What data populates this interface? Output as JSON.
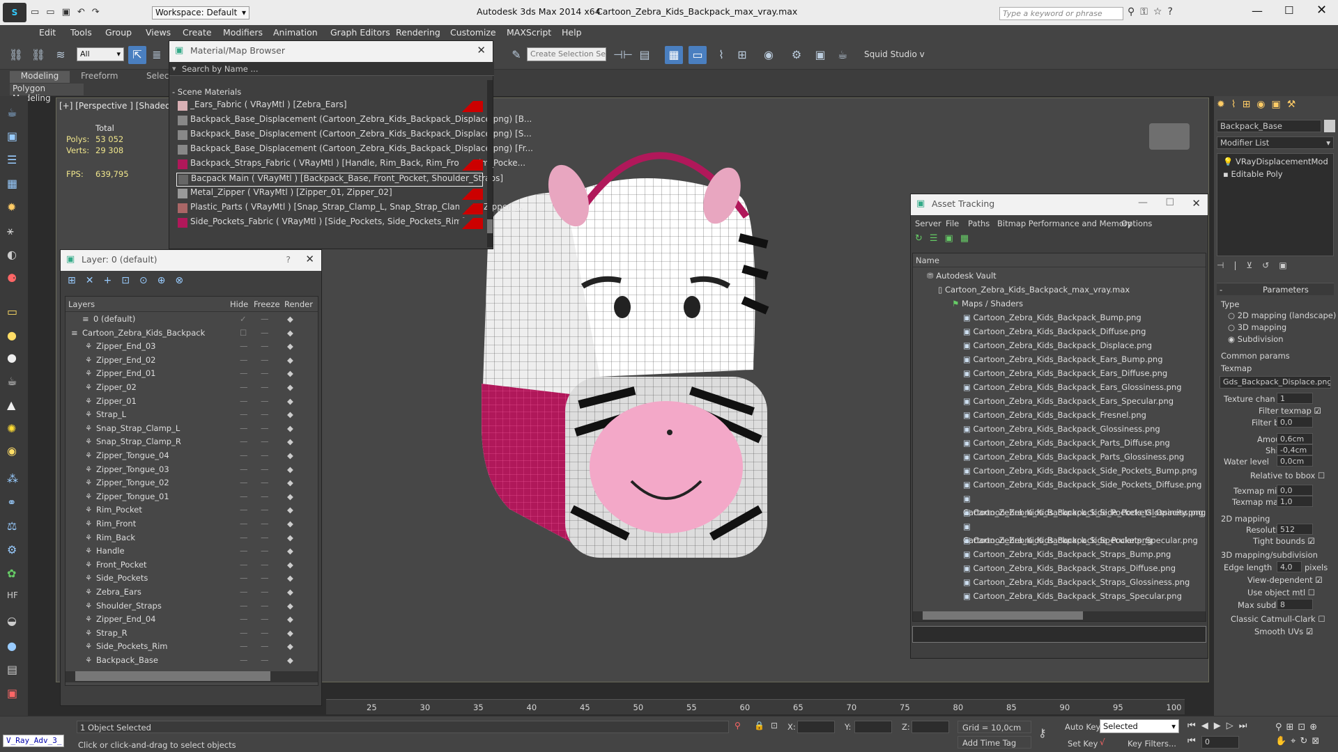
{
  "titlebar": {
    "workspace": "Workspace: Default",
    "app": "Autodesk 3ds Max  2014 x64",
    "file": "Cartoon_Zebra_Kids_Backpack_max_vray.max",
    "search_placeholder": "Type a keyword or phrase"
  },
  "menu": [
    "Edit",
    "Tools",
    "Group",
    "Views",
    "Create",
    "Modifiers",
    "Animation",
    "Graph Editors",
    "Rendering",
    "Customize",
    "MAXScript",
    "Help"
  ],
  "toolbar": {
    "filter": "All",
    "named_selection": "Create Selection Se",
    "plugin": "Squid Studio v"
  },
  "ribbon": {
    "tabs": [
      "Modeling",
      "Freeform",
      "Selec"
    ],
    "sub": "Polygon Modeling"
  },
  "viewport": {
    "label": "[+] [Perspective ] [Shaded +",
    "stats_total": "Total",
    "polys_label": "Polys:",
    "polys": "53 052",
    "verts_label": "Verts:",
    "verts": "29 308",
    "fps_label": "FPS:",
    "fps": "639,795"
  },
  "material_browser": {
    "title": "Material/Map Browser",
    "search": "Search by Name ...",
    "section": "- Scene Materials",
    "items": [
      "_Ears_Fabric  ( VRayMtl ) [Zebra_Ears]",
      "Backpack_Base_Displacement (Cartoon_Zebra_Kids_Backpack_Displace.png) [B...",
      "Backpack_Base_Displacement (Cartoon_Zebra_Kids_Backpack_Displace.png) [S...",
      "Backpack_Base_Displacement (Cartoon_Zebra_Kids_Backpack_Displace.png) [Fr...",
      "Backpack_Straps_Fabric  ( VRayMtl ) [Handle, Rim_Back, Rim_Front, Rim_Pocke...",
      "Bacpack Main  ( VRayMtl ) [Backpack_Base, Front_Pocket, Shoulder_Straps]",
      "Metal_Zipper  ( VRayMtl ) [Zipper_01, Zipper_02]",
      "Plastic_Parts  ( VRayMtl ) [Snap_Strap_Clamp_L, Snap_Strap_Clamp_R, Zipper_...",
      "Side_Pockets_Fabric  ( VRayMtl ) [Side_Pockets, Side_Pockets_Rim]"
    ]
  },
  "layers": {
    "title": "Layer: 0 (default)",
    "help": "?",
    "cols": [
      "Layers",
      "Hide",
      "Freeze",
      "Render"
    ],
    "items": [
      "0 (default)",
      "Cartoon_Zebra_Kids_Backpack",
      "Zipper_End_03",
      "Zipper_End_02",
      "Zipper_End_01",
      "Zipper_02",
      "Zipper_01",
      "Strap_L",
      "Snap_Strap_Clamp_L",
      "Snap_Strap_Clamp_R",
      "Zipper_Tongue_04",
      "Zipper_Tongue_03",
      "Zipper_Tongue_02",
      "Zipper_Tongue_01",
      "Rim_Pocket",
      "Rim_Front",
      "Rim_Back",
      "Handle",
      "Front_Pocket",
      "Side_Pockets",
      "Zebra_Ears",
      "Shoulder_Straps",
      "Zipper_End_04",
      "Strap_R",
      "Side_Pockets_Rim",
      "Backpack_Base"
    ]
  },
  "asset_tracking": {
    "title": "Asset Tracking",
    "menu": [
      "Server",
      "File",
      "Paths",
      "Bitmap Performance and Memory",
      "Options"
    ],
    "col": "Name",
    "vault": "Autodesk Vault",
    "file": "Cartoon_Zebra_Kids_Backpack_max_vray.max",
    "maps": "Maps / Shaders",
    "items": [
      "Cartoon_Zebra_Kids_Backpack_Bump.png",
      "Cartoon_Zebra_Kids_Backpack_Diffuse.png",
      "Cartoon_Zebra_Kids_Backpack_Displace.png",
      "Cartoon_Zebra_Kids_Backpack_Ears_Bump.png",
      "Cartoon_Zebra_Kids_Backpack_Ears_Diffuse.png",
      "Cartoon_Zebra_Kids_Backpack_Ears_Glossiness.png",
      "Cartoon_Zebra_Kids_Backpack_Ears_Specular.png",
      "Cartoon_Zebra_Kids_Backpack_Fresnel.png",
      "Cartoon_Zebra_Kids_Backpack_Glossiness.png",
      "Cartoon_Zebra_Kids_Backpack_Parts_Diffuse.png",
      "Cartoon_Zebra_Kids_Backpack_Parts_Glossiness.png",
      "Cartoon_Zebra_Kids_Backpack_Side_Pockets_Bump.png",
      "Cartoon_Zebra_Kids_Backpack_Side_Pockets_Diffuse.png",
      "Cartoon_Zebra_Kids_Backpack_Side_Pockets_Glossiness.png",
      "Cartoon_Zebra_Kids_Backpack_Side_Pockets_Opacity.png",
      "Cartoon_Zebra_Kids_Backpack_Side_Pockets_Specular.png",
      "Cartoon_Zebra_Kids_Backpack_Specular.png",
      "Cartoon_Zebra_Kids_Backpack_Straps_Bump.png",
      "Cartoon_Zebra_Kids_Backpack_Straps_Diffuse.png",
      "Cartoon_Zebra_Kids_Backpack_Straps_Glossiness.png",
      "Cartoon_Zebra_Kids_Backpack_Straps_Specular.png"
    ]
  },
  "cmd": {
    "object": "Backpack_Base",
    "modifier_list": "Modifier List",
    "stack": [
      "VRayDisplacementMod",
      "Editable Poly"
    ],
    "params": "Parameters",
    "type": "Type",
    "types": [
      "2D mapping (landscape)",
      "3D mapping",
      "Subdivision"
    ],
    "common": "Common params",
    "texmap": "Texmap",
    "texmap_val": "Gds_Backpack_Displace.png)",
    "tex_chan": "Texture chan",
    "tex_chan_v": "1",
    "filter_texmap": "Filter texmap",
    "filter_blur": "Filter blur",
    "filter_blur_v": "0,0",
    "amount": "Amount",
    "amount_v": "0,6cm",
    "shift": "Shift",
    "shift_v": "-0,4cm",
    "water": "Water level",
    "water_v": "0,0cm",
    "relbbox": "Relative to bbox",
    "texmin": "Texmap min",
    "texmin_v": "0,0",
    "texmax": "Texmap max",
    "texmax_v": "1,0",
    "map2d": "2D mapping",
    "res": "Resolution",
    "res_v": "512",
    "tight": "Tight bounds",
    "map3d": "3D mapping/subdivision",
    "edge": "Edge length",
    "edge_v": "4,0",
    "pixels": "pixels",
    "viewdep": "View-dependent",
    "useobj": "Use object mtl",
    "maxsub": "Max subdivs",
    "maxsub_v": "8",
    "catmull": "Classic Catmull-Clark",
    "smooth": "Smooth UVs"
  },
  "timeline": {
    "ticks": [
      "25",
      "30",
      "35",
      "40",
      "45",
      "50",
      "55",
      "60",
      "65",
      "70",
      "75",
      "80",
      "85",
      "90",
      "95",
      "100"
    ]
  },
  "status": {
    "script": "V_Ray_Adv_3_",
    "selected": "1 Object Selected",
    "hint": "Click or click-and-drag to select objects",
    "x": "X:",
    "y": "Y:",
    "z": "Z:",
    "grid": "Grid = 10,0cm",
    "autokey": "Auto Key",
    "selected_dd": "Selected",
    "setkey": "Set Key",
    "keyfilters": "Key Filters...",
    "addtag": "Add Time Tag",
    "frame": "0"
  }
}
